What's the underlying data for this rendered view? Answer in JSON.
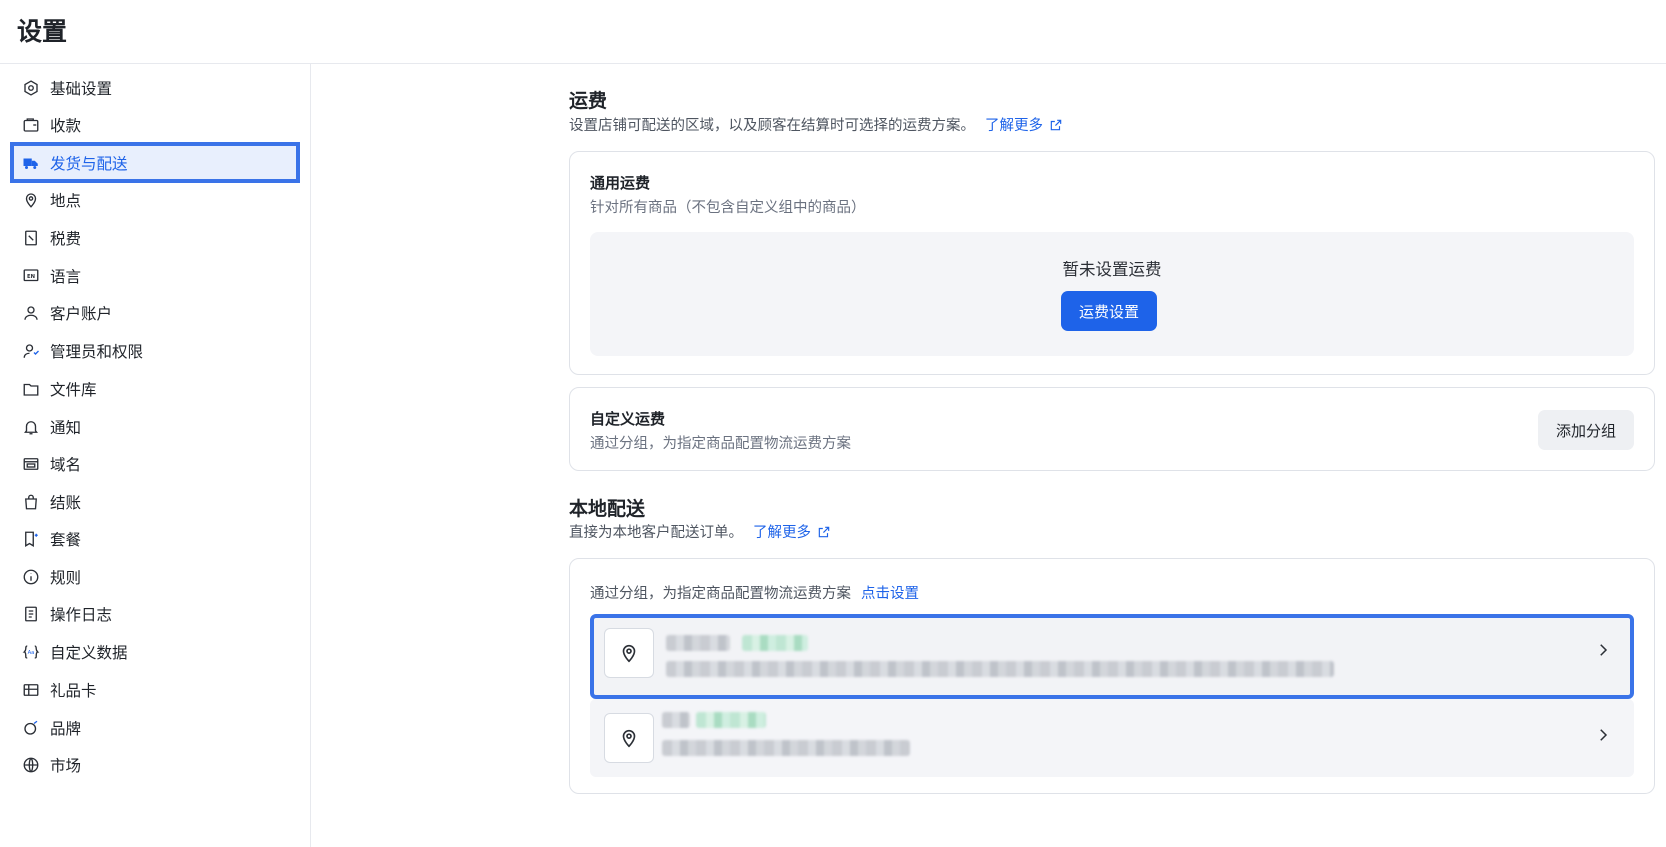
{
  "header": {
    "title": "设置"
  },
  "sidebar": {
    "items": [
      {
        "label": "基础设置",
        "icon": "settings-hex-icon"
      },
      {
        "label": "收款",
        "icon": "wallet-icon"
      },
      {
        "label": "发货与配送",
        "icon": "truck-icon",
        "active": true
      },
      {
        "label": "地点",
        "icon": "location-pin-icon"
      },
      {
        "label": "税费",
        "icon": "receipt-tax-icon"
      },
      {
        "label": "语言",
        "icon": "language-en-icon"
      },
      {
        "label": "客户账户",
        "icon": "user-icon"
      },
      {
        "label": "管理员和权限",
        "icon": "user-shield-icon"
      },
      {
        "label": "文件库",
        "icon": "folder-icon"
      },
      {
        "label": "通知",
        "icon": "bell-icon"
      },
      {
        "label": "域名",
        "icon": "domain-icon"
      },
      {
        "label": "结账",
        "icon": "shopping-bag-icon"
      },
      {
        "label": "套餐",
        "icon": "plan-icon"
      },
      {
        "label": "规则",
        "icon": "info-circle-icon"
      },
      {
        "label": "操作日志",
        "icon": "log-icon"
      },
      {
        "label": "自定义数据",
        "icon": "custom-data-icon"
      },
      {
        "label": "礼品卡",
        "icon": "gift-card-icon"
      },
      {
        "label": "品牌",
        "icon": "brand-icon"
      },
      {
        "label": "市场",
        "icon": "globe-icon"
      }
    ]
  },
  "shipping": {
    "title": "运费",
    "description": "设置店铺可配送的区域，以及顾客在结算时可选择的运费方案。",
    "learn_more": "了解更多",
    "general": {
      "title": "通用运费",
      "subtitle": "针对所有商品（不包含自定义组中的商品）",
      "empty_text": "暂未设置运费",
      "button": "运费设置"
    },
    "custom": {
      "title": "自定义运费",
      "subtitle": "通过分组，为指定商品配置物流运费方案",
      "button": "添加分组"
    }
  },
  "local_delivery": {
    "title": "本地配送",
    "description": "直接为本地客户配送订单。",
    "learn_more": "了解更多",
    "card_text": "通过分组，为指定商品配置物流运费方案",
    "card_link": "点击设置"
  },
  "colors": {
    "accent": "#1e63e9",
    "active_bg": "#e8effd",
    "highlight_border": "#3a73e8"
  }
}
